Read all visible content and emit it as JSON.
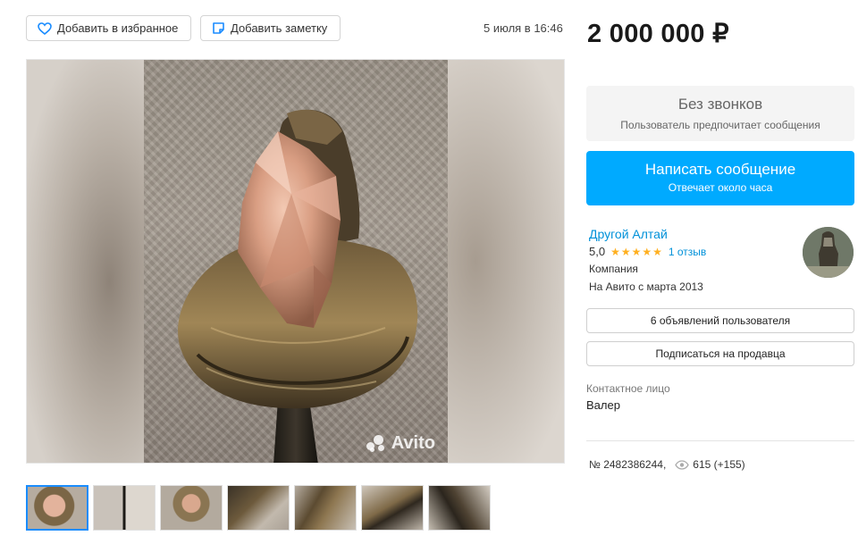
{
  "actions": {
    "favorite_label": "Добавить в избранное",
    "note_label": "Добавить заметку"
  },
  "listing": {
    "date": "5 июля в 16:46",
    "price": "2 000 000 ₽",
    "number": "№ 2482386244,",
    "views": "615 (+155)"
  },
  "gallery": {
    "watermark": "Avito",
    "thumbnail_count": 7
  },
  "contact_box": {
    "title": "Без звонков",
    "subtitle": "Пользователь предпочитает сообщения"
  },
  "message_button": {
    "label": "Написать сообщение",
    "sublabel": "Отвечает около часа"
  },
  "seller": {
    "name": "Другой Алтай",
    "rating": "5,0",
    "stars": "★★★★★",
    "reviews": "1 отзыв",
    "type": "Компания",
    "since": "На Авито с марта 2013",
    "ads_button": "6 объявлений пользователя",
    "subscribe_button": "Подписаться на продавца"
  },
  "contact_person": {
    "label": "Контактное лицо",
    "name": "Валер"
  },
  "colors": {
    "accent": "#00aaff",
    "link": "#0091d9",
    "stars": "#ffb021"
  }
}
